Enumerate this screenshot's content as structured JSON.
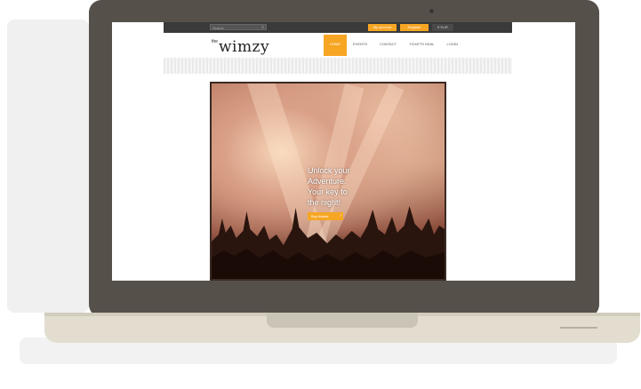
{
  "topbar": {
    "search_placeholder": "Search",
    "search_icon": "search-icon",
    "user_icon": "user-icon",
    "account_label": "My account",
    "register_label": "Register",
    "currency_label": "€ EUR"
  },
  "brand": {
    "prefix": "the",
    "name": "wimzy"
  },
  "nav": {
    "items": [
      {
        "label": "Home",
        "active": true
      },
      {
        "label": "Events",
        "active": false
      },
      {
        "label": "Contact",
        "active": false
      },
      {
        "label": "Tickets Deal",
        "active": false
      },
      {
        "label": "Login",
        "active": false
      }
    ]
  },
  "hero": {
    "line1": "Unlock your",
    "line2": "Adventure.",
    "line3": "Your key to",
    "line4": "the night!",
    "cta_label": "Buy tickets",
    "cta_icon": "chevron-right-icon"
  },
  "colors": {
    "accent": "#f6a623",
    "bezel": "#56504b",
    "base": "#e2ddcf"
  }
}
